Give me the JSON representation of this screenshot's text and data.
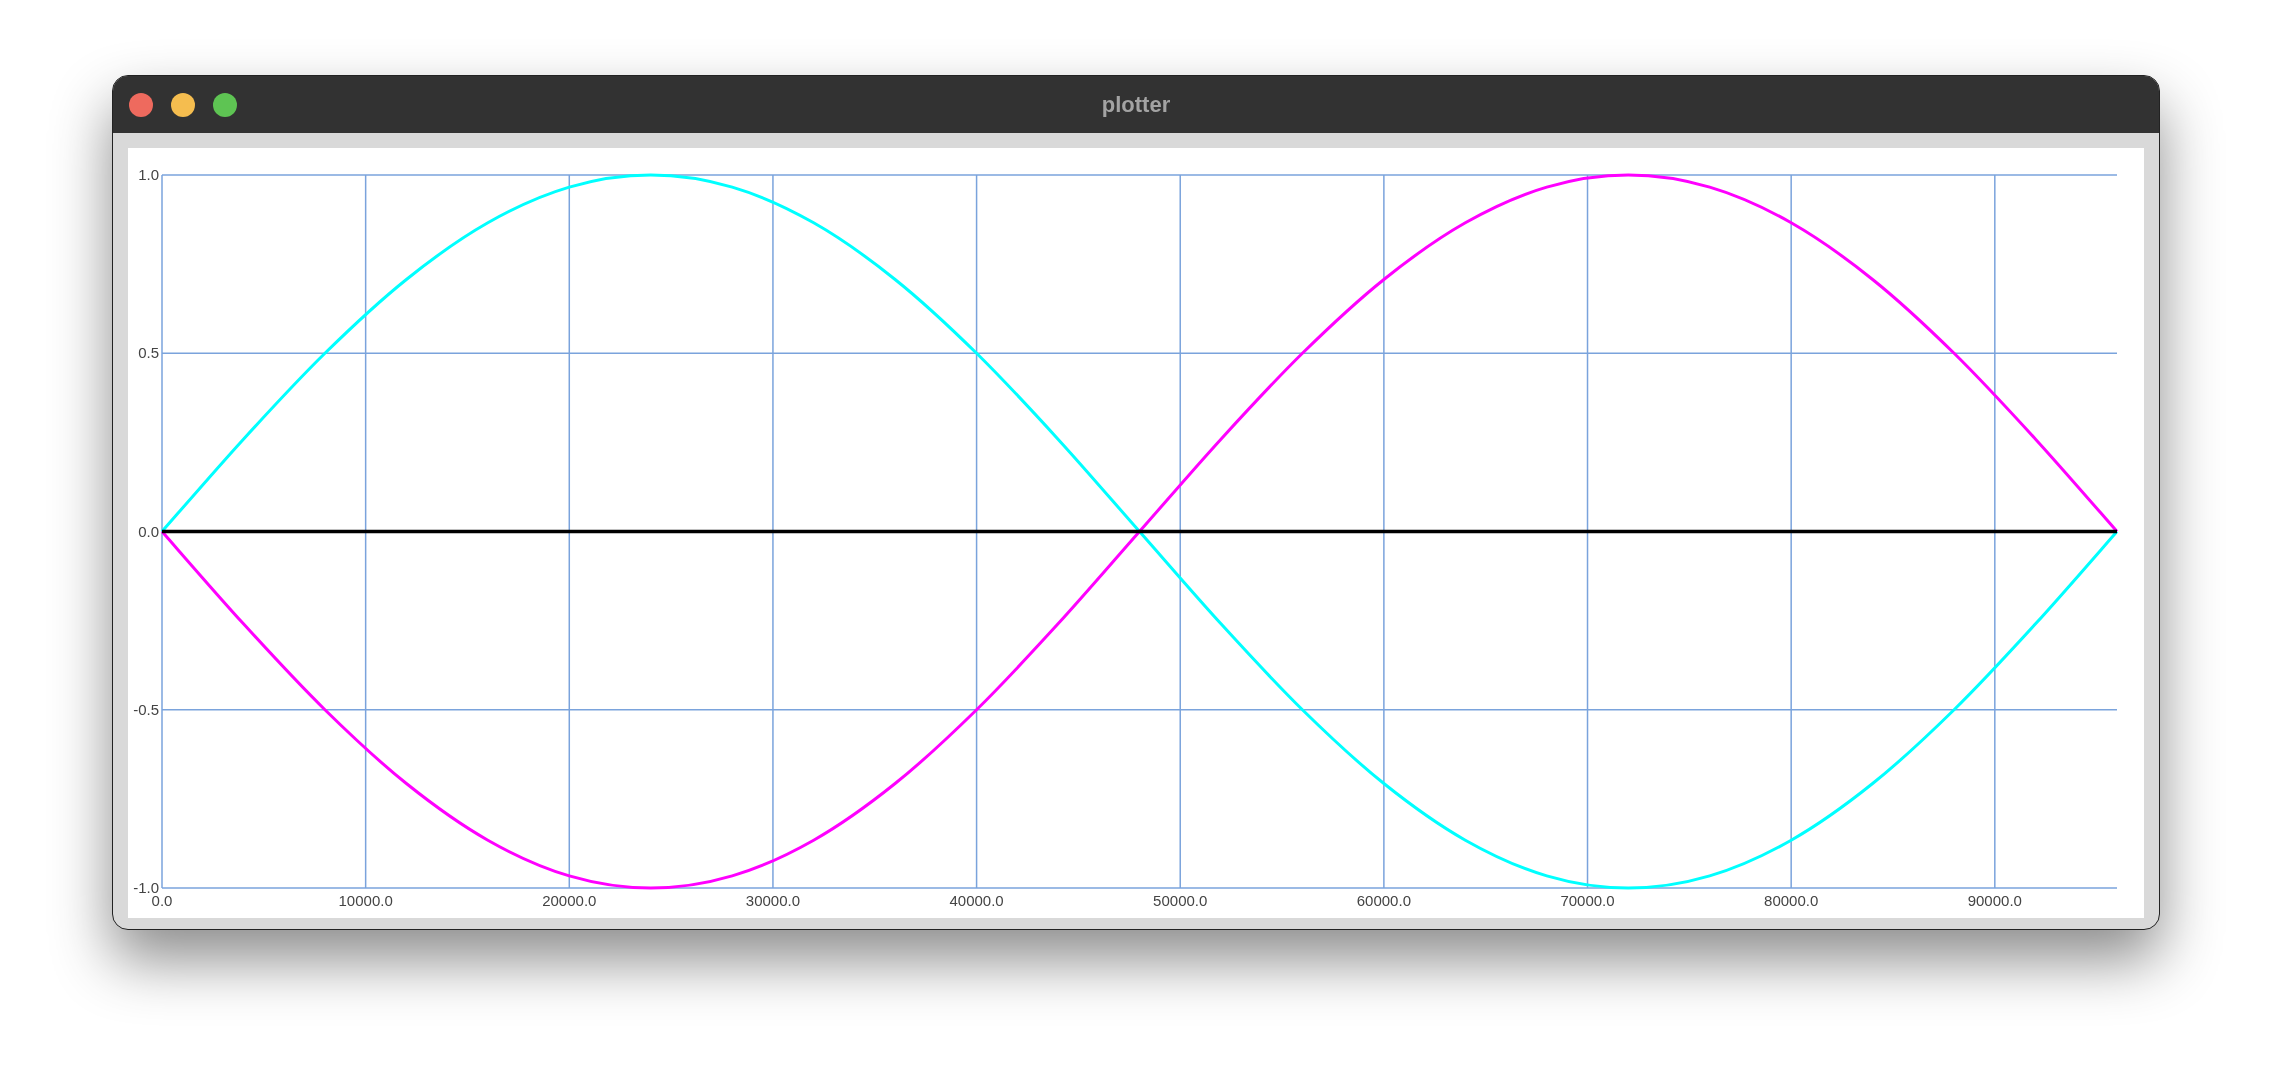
{
  "window": {
    "title": "plotter"
  },
  "plot": {
    "chart_data": {
      "type": "line",
      "x": [
        0,
        4000,
        8000,
        12000,
        16000,
        20000,
        24000,
        28000,
        32000,
        36000,
        40000,
        44000,
        48000,
        52000,
        56000,
        60000,
        64000,
        68000,
        72000,
        76000,
        80000,
        84000,
        88000,
        92000,
        96000
      ],
      "series": [
        {
          "color": "#00ffff",
          "values": [
            0,
            0.259,
            0.5,
            0.707,
            0.866,
            0.966,
            1,
            0.966,
            0.866,
            0.707,
            0.5,
            0.259,
            0,
            -0.259,
            -0.5,
            -0.707,
            -0.866,
            -0.966,
            -1,
            -0.966,
            -0.866,
            -0.707,
            -0.5,
            -0.259,
            0
          ]
        },
        {
          "color": "#ff00ff",
          "values": [
            0,
            -0.259,
            -0.5,
            -0.707,
            -0.866,
            -0.966,
            -1,
            -0.966,
            -0.866,
            -0.707,
            -0.5,
            -0.259,
            0,
            0.259,
            0.5,
            0.707,
            0.866,
            0.966,
            1,
            0.966,
            0.866,
            0.707,
            0.5,
            0.259,
            0
          ]
        },
        {
          "color": "#000000",
          "values": [
            0,
            0,
            0,
            0,
            0,
            0,
            0,
            0,
            0,
            0,
            0,
            0,
            0,
            0,
            0,
            0,
            0,
            0,
            0,
            0,
            0,
            0,
            0,
            0,
            0
          ]
        }
      ],
      "xlim": [
        0,
        96000
      ],
      "grid": true,
      "ylim": [
        -1,
        1
      ],
      "xticks": [
        {
          "value": 0,
          "label": "0.0"
        },
        {
          "value": 10000,
          "label": "10000.0"
        },
        {
          "value": 20000,
          "label": "20000.0"
        },
        {
          "value": 30000,
          "label": "30000.0"
        },
        {
          "value": 40000,
          "label": "40000.0"
        },
        {
          "value": 50000,
          "label": "50000.0"
        },
        {
          "value": 60000,
          "label": "60000.0"
        },
        {
          "value": 70000,
          "label": "70000.0"
        },
        {
          "value": 80000,
          "label": "80000.0"
        },
        {
          "value": 90000,
          "label": "90000.0"
        }
      ],
      "yticks": [
        {
          "value": -1,
          "label": "-1.0"
        },
        {
          "value": -0.5,
          "label": "-0.5"
        },
        {
          "value": 0,
          "label": "0.0"
        },
        {
          "value": 0.5,
          "label": "0.5"
        },
        {
          "value": 1,
          "label": "1.0"
        }
      ]
    }
  }
}
